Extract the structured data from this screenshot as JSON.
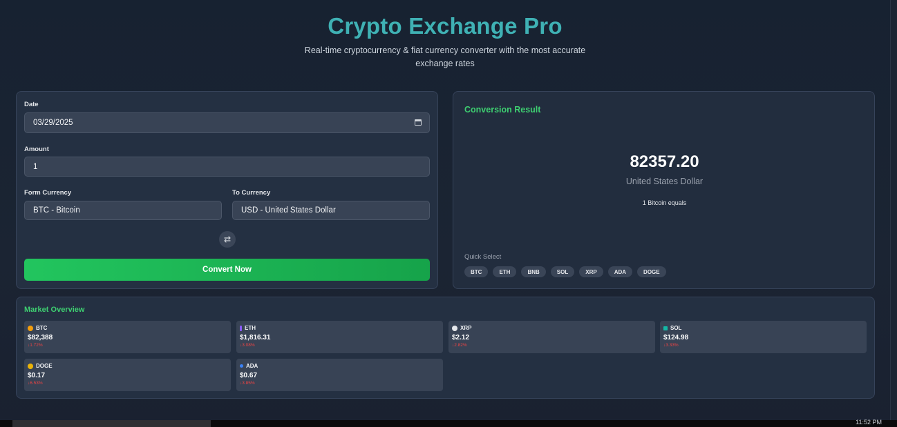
{
  "app": {
    "title": "Crypto Exchange Pro",
    "subtitle": "Real-time cryptocurrency & fiat currency converter with the most accurate exchange rates"
  },
  "form": {
    "date_label": "Date",
    "date_value": "03/29/2025",
    "amount_label": "Amount",
    "amount_value": "1",
    "from_label": "Form Currency",
    "from_value": "BTC - Bitcoin",
    "to_label": "To Currency",
    "to_value": "USD - United States Dollar",
    "swap_icon": "swap-arrows-icon",
    "convert_label": "Convert Now"
  },
  "result": {
    "heading": "Conversion Result",
    "amount": "82357.20",
    "currency": "United States Dollar",
    "equals_text": "1 Bitcoin equals",
    "quick_select_label": "Quick Select",
    "quick_select": [
      "BTC",
      "ETH",
      "BNB",
      "SOL",
      "XRP",
      "ADA",
      "DOGE"
    ]
  },
  "market": {
    "heading": "Market Overview",
    "cards": [
      {
        "symbol": "BTC",
        "price": "$82,388",
        "change": "↓1.72%",
        "icon_color": "#f59e0b",
        "icon": "bitcoin-icon"
      },
      {
        "symbol": "ETH",
        "price": "$1,816.31",
        "change": "↓3.08%",
        "icon_color": "#8b5cf6",
        "icon": "ethereum-icon"
      },
      {
        "symbol": "XRP",
        "price": "$2.12",
        "change": "↓2.82%",
        "icon_color": "#e5e7eb",
        "icon": "xrp-icon"
      },
      {
        "symbol": "SOL",
        "price": "$124.98",
        "change": "↓3.33%",
        "icon_color": "#14b8a6",
        "icon": "solana-icon"
      },
      {
        "symbol": "DOGE",
        "price": "$0.17",
        "change": "↓6.53%",
        "icon_color": "#eab308",
        "icon": "dogecoin-icon"
      },
      {
        "symbol": "ADA",
        "price": "$0.67",
        "change": "↓3.85%",
        "icon_color": "#3b82f6",
        "icon": "cardano-icon"
      }
    ]
  },
  "colors": {
    "accent_title": "#3fb1b4",
    "accent_green": "#3ecf71",
    "negative": "#ef4444"
  },
  "taskbar": {
    "clock": "11:52 PM"
  }
}
